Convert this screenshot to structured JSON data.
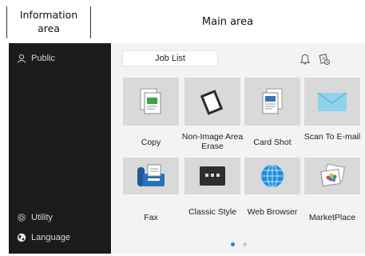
{
  "captions": {
    "information_area": "Information area",
    "main_area": "Main area"
  },
  "sidebar": {
    "public_label": "Public",
    "utility_label": "Utility",
    "language_label": "Language"
  },
  "header": {
    "job_list_label": "Job List",
    "icons": [
      "bell-icon",
      "job-status-icon"
    ]
  },
  "tiles": [
    {
      "label": "Copy",
      "icon": "copy-icon"
    },
    {
      "label": "Non-Image Area Erase",
      "icon": "non-image-area-erase-icon"
    },
    {
      "label": "Card Shot",
      "icon": "card-shot-icon"
    },
    {
      "label": "Scan To E-mail",
      "icon": "envelope-icon"
    },
    {
      "label": "Fax",
      "icon": "fax-icon"
    },
    {
      "label": "Classic Style",
      "icon": "classic-style-icon"
    },
    {
      "label": "Web Browser",
      "icon": "globe-icon"
    },
    {
      "label": "MarketPlace",
      "icon": "marketplace-icon"
    }
  ],
  "pager": {
    "pages": 2,
    "current": 1
  },
  "colors": {
    "sidebar_bg": "#1b1b1b",
    "main_bg": "#f3f3f3",
    "tile_bg": "#d9d9d9",
    "accent": "#2f80d8"
  }
}
